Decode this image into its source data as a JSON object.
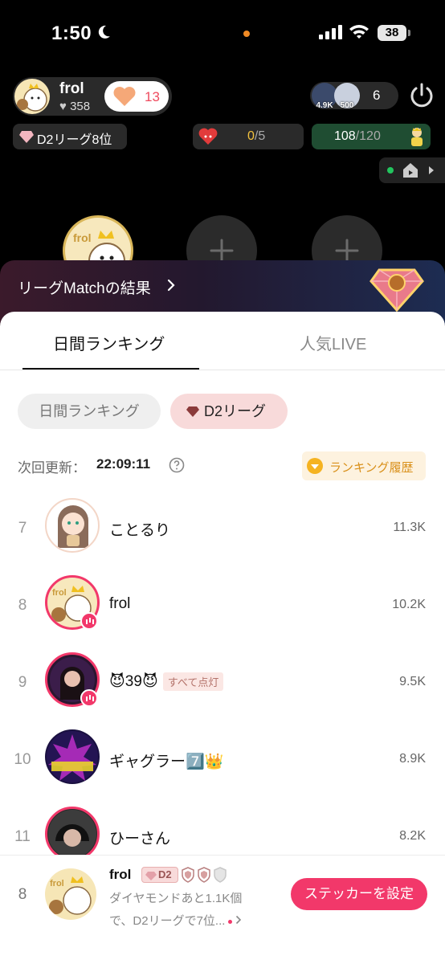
{
  "status_bar": {
    "time": "1:50",
    "battery": "38"
  },
  "host": {
    "name": "frol",
    "likes": "358",
    "like_button_count": "13"
  },
  "viewers": {
    "badge_a": "4.9K",
    "badge_b": "500",
    "count": "6"
  },
  "league_badge": "D2リーグ8位",
  "mission": {
    "done": "0",
    "total": "/5"
  },
  "xp": {
    "current": "108",
    "total": "/120"
  },
  "match_banner": {
    "label": "リーグMatchの結果"
  },
  "tabs": [
    {
      "label": "日間ランキング",
      "active": true
    },
    {
      "label": "人気LIVE",
      "active": false
    }
  ],
  "chips": [
    {
      "label": "日間ランキング",
      "active": false
    },
    {
      "label": "D2リーグ",
      "active": true
    }
  ],
  "update": {
    "label": "次回更新：",
    "time": "22:09:11"
  },
  "history_button": "ランキング履歴",
  "ranking": [
    {
      "rank": "7",
      "name": "ことるり",
      "score": "11.3K",
      "tag": ""
    },
    {
      "rank": "8",
      "name": "frol",
      "score": "10.2K",
      "tag": ""
    },
    {
      "rank": "9",
      "name": "😈39😈",
      "score": "9.5K",
      "tag": "すべて点灯"
    },
    {
      "rank": "10",
      "name": "ギャグラー7️⃣👑",
      "score": "8.9K",
      "tag": ""
    },
    {
      "rank": "11",
      "name": "ひーさん",
      "score": "8.2K",
      "tag": ""
    }
  ],
  "me": {
    "rank": "8",
    "name": "frol",
    "badge": "D2",
    "desc_line1": "ダイヤモンドあと1.1K個",
    "desc_line2": "で、D2リーグで7位...",
    "button": "ステッカーを設定"
  },
  "colors": {
    "accent": "#f2386a",
    "gold": "#d9901a",
    "league_chip_bg": "#f8dada"
  }
}
